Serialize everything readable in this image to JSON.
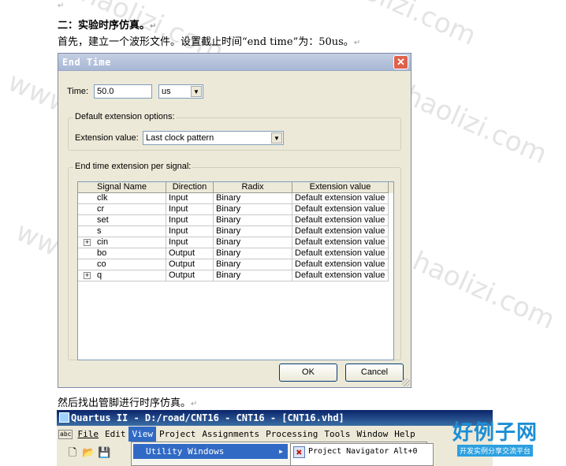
{
  "watermark_text": "www.haolizi.com",
  "document": {
    "para_mark": "↵",
    "heading": "二：实验时序仿真。",
    "intro": "首先，建立一个波形文件。设置截止时间“end time”为：50us。",
    "after_text": "然后找出管脚进行时序仿真。"
  },
  "dialog": {
    "title": "End Time",
    "time_label": "Time:",
    "time_value": "50.0",
    "unit_value": "us",
    "default_group_title": "Default extension options:",
    "extension_label": "Extension value:",
    "extension_value": "Last clock pattern",
    "per_signal_group_title": "End time extension per signal:",
    "table": {
      "headers": [
        "Signal Name",
        "Direction",
        "Radix",
        "Extension value"
      ],
      "rows": [
        {
          "name": "clk",
          "direction": "Input",
          "radix": "Binary",
          "ext": "Default extension value",
          "expandable": false
        },
        {
          "name": "cr",
          "direction": "Input",
          "radix": "Binary",
          "ext": "Default extension value",
          "expandable": false
        },
        {
          "name": "set",
          "direction": "Input",
          "radix": "Binary",
          "ext": "Default extension value",
          "expandable": false
        },
        {
          "name": "s",
          "direction": "Input",
          "radix": "Binary",
          "ext": "Default extension value",
          "expandable": false
        },
        {
          "name": "cin",
          "direction": "Input",
          "radix": "Binary",
          "ext": "Default extension value",
          "expandable": true
        },
        {
          "name": "bo",
          "direction": "Output",
          "radix": "Binary",
          "ext": "Default extension value",
          "expandable": false
        },
        {
          "name": "co",
          "direction": "Output",
          "radix": "Binary",
          "ext": "Default extension value",
          "expandable": false
        },
        {
          "name": "q",
          "direction": "Output",
          "radix": "Binary",
          "ext": "Default extension value",
          "expandable": true
        }
      ]
    },
    "ok_label": "OK",
    "cancel_label": "Cancel",
    "close_glyph": "✕"
  },
  "quartus": {
    "title": "Quartus II - D:/road/CNT16 - CNT16 - [CNT16.vhd]",
    "menu_icon_label": "abc",
    "menu": [
      "File",
      "Edit",
      "View",
      "Project",
      "Assignments",
      "Processing",
      "Tools",
      "Window",
      "Help"
    ],
    "active_menu": "View",
    "view_menu_selected": "Utility Windows",
    "submenu_item": "Project Navigator",
    "submenu_shortcut": "Alt+0"
  },
  "logo": {
    "big": "好例子网",
    "small": "开发实例分享交流平台"
  },
  "icons": [
    "new-file-icon",
    "open-folder-icon",
    "save-icon",
    "project-navigator-icon",
    "close-icon",
    "submenu-arrow-icon",
    "dropdown-arrow-icon",
    "expand-icon"
  ]
}
